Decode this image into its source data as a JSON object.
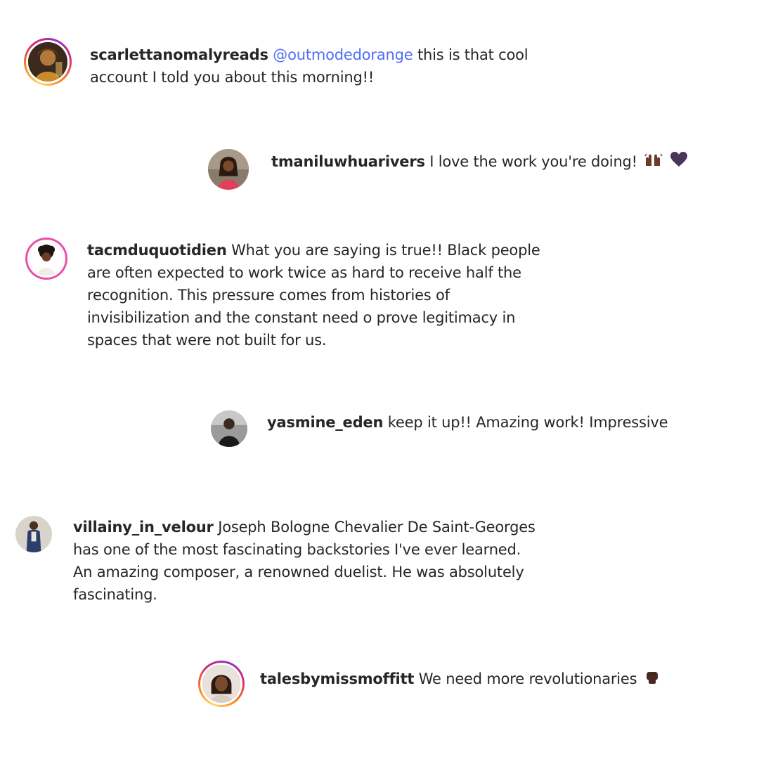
{
  "comments": [
    {
      "username": "scarlettanomalyreads",
      "mention": "@outmodedorange",
      "text_line1": "this is that cool",
      "text_line2": "account I told you about this morning!!"
    },
    {
      "username": "tmaniluwhuarivers",
      "text": "I love the work you're doing!",
      "emojis": [
        "raising-hands-icon",
        "purple-heart-icon"
      ]
    },
    {
      "username": "tacmduquotidien",
      "lines": [
        "What you are saying is true!! Black people",
        "are often expected to work twice as hard to receive half the",
        "recognition. This pressure comes from histories of",
        "invisibilization and the constant need o prove legitimacy in",
        "spaces that were not built for us."
      ]
    },
    {
      "username": "yasmine_eden",
      "text": "keep it up!! Amazing work! Impressive"
    },
    {
      "username": "villainy_in_velour",
      "lines": [
        "Joseph Bologne Chevalier De Saint-Georges",
        "has one of the most fascinating backstories I've ever learned.",
        "An amazing composer, a renowned duelist. He was absolutely",
        "fascinating."
      ]
    },
    {
      "username": "talesbymissmoffitt",
      "text": "We need more revolutionaries",
      "emojis": [
        "raised-fist-icon"
      ]
    }
  ],
  "colors": {
    "mention": "#4f6ef7",
    "text": "#262626",
    "story_ring": "#d62976"
  }
}
